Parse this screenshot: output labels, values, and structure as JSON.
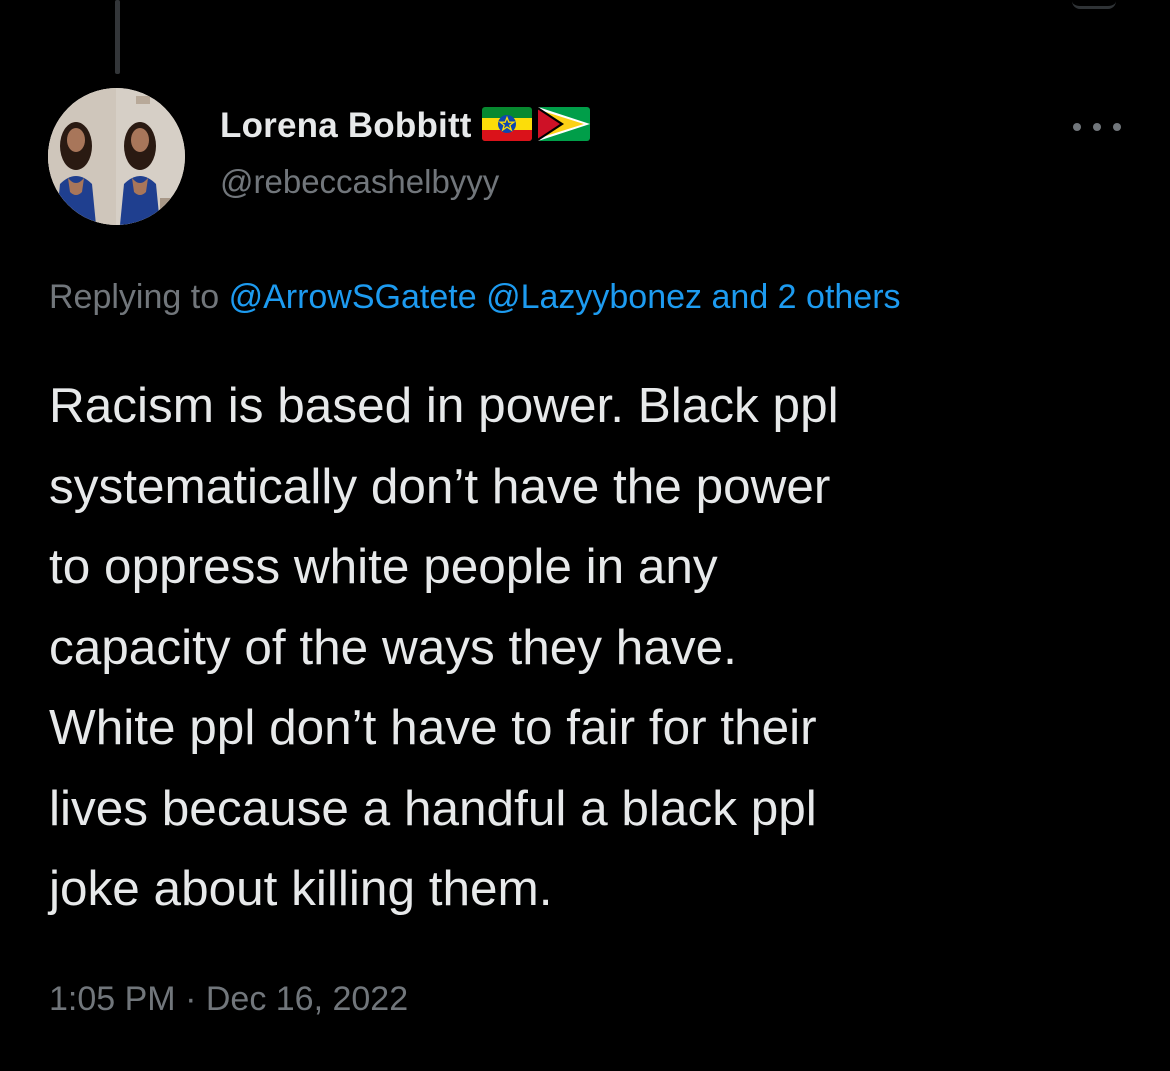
{
  "tweet": {
    "author": {
      "display_name": "Lorena Bobbitt",
      "handle": "@rebeccashelbyyy",
      "flags": [
        "ethiopia-flag",
        "guyana-flag"
      ]
    },
    "reply": {
      "prefix": "Replying to",
      "mentions": [
        "@ArrowSGatete",
        "@Lazyybonez"
      ],
      "others": "and 2 others"
    },
    "text": "Racism is based in power. Black ppl\nsystematically don’t have the power\nto oppress white people in any\ncapacity of the ways they have.\nWhite ppl don’t have to fair for their\nlives because a handful a black ppl\njoke about killing them.",
    "time": "1:05 PM",
    "separator": "·",
    "date": "Dec 16, 2022",
    "more_icon": "more-horizontal-icon"
  },
  "colors": {
    "background": "#000000",
    "primary_text": "#e7e9ea",
    "secondary_text": "#71767b",
    "link": "#1d9bf0"
  }
}
